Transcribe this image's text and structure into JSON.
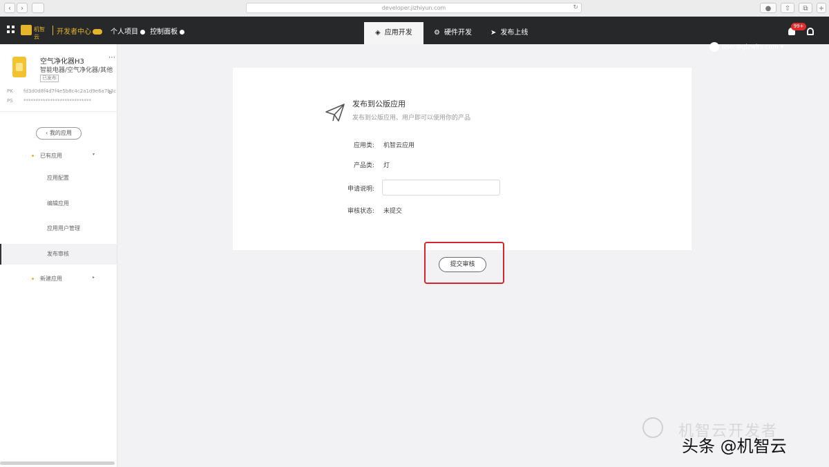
{
  "browser": {
    "url": "developer.jizhiyun.com",
    "back_label": "‹",
    "forward_label": "›"
  },
  "nav": {
    "logo_text": "机智云",
    "dev_center": "开发者中心",
    "personal_project": "个人项目",
    "console": "控制面板",
    "tabs": [
      {
        "label": "应用开发",
        "icon": "diamond-icon",
        "active": true
      },
      {
        "label": "硬件开发",
        "icon": "chip-icon",
        "active": false
      },
      {
        "label": "发布上线",
        "icon": "send-icon",
        "active": false
      }
    ],
    "user_email": "user@gizwits.com",
    "user_caret": "▾",
    "notification_badge": "99+"
  },
  "sidebar": {
    "product_name": "空气净化器H3",
    "product_desc": "智能电器/空气净化器/其他",
    "product_tag": "已发布",
    "more": "⋯",
    "meta": [
      {
        "key": "PK",
        "value": "fd3d0d8f4d7f4e5b8c4c2a1d9e6a7b3c"
      },
      {
        "key": "PS",
        "value": "****************************"
      }
    ],
    "back_label": "‹ 我的应用",
    "groups": [
      {
        "label": "已有应用",
        "caret": "▾",
        "expanded": true
      },
      {
        "label": "新建应用",
        "caret": "▸",
        "expanded": false
      }
    ],
    "items": [
      "应用配置",
      "编辑应用",
      "应用用户管理",
      "发布审核"
    ],
    "active_item": "发布审核"
  },
  "main": {
    "title": "发布到公版应用",
    "subtitle": "发布到公版应用、用户即可以使用你的产品",
    "fields": [
      {
        "label": "应用类:",
        "value": "机智云应用"
      },
      {
        "label": "产品类:",
        "value": "灯"
      }
    ],
    "apply_label": "申请说明:",
    "apply_value": "",
    "status_label": "审核状态:",
    "status_value": "未提交",
    "submit_label": "提交审核"
  },
  "watermark": {
    "line1": "机智云开发者",
    "line2": "头条 @机智云"
  },
  "colors": {
    "nav_bg": "#272829",
    "brand_yellow": "#e5b42a",
    "highlight_red": "#d0262d",
    "badge_red": "#e02b2b"
  }
}
